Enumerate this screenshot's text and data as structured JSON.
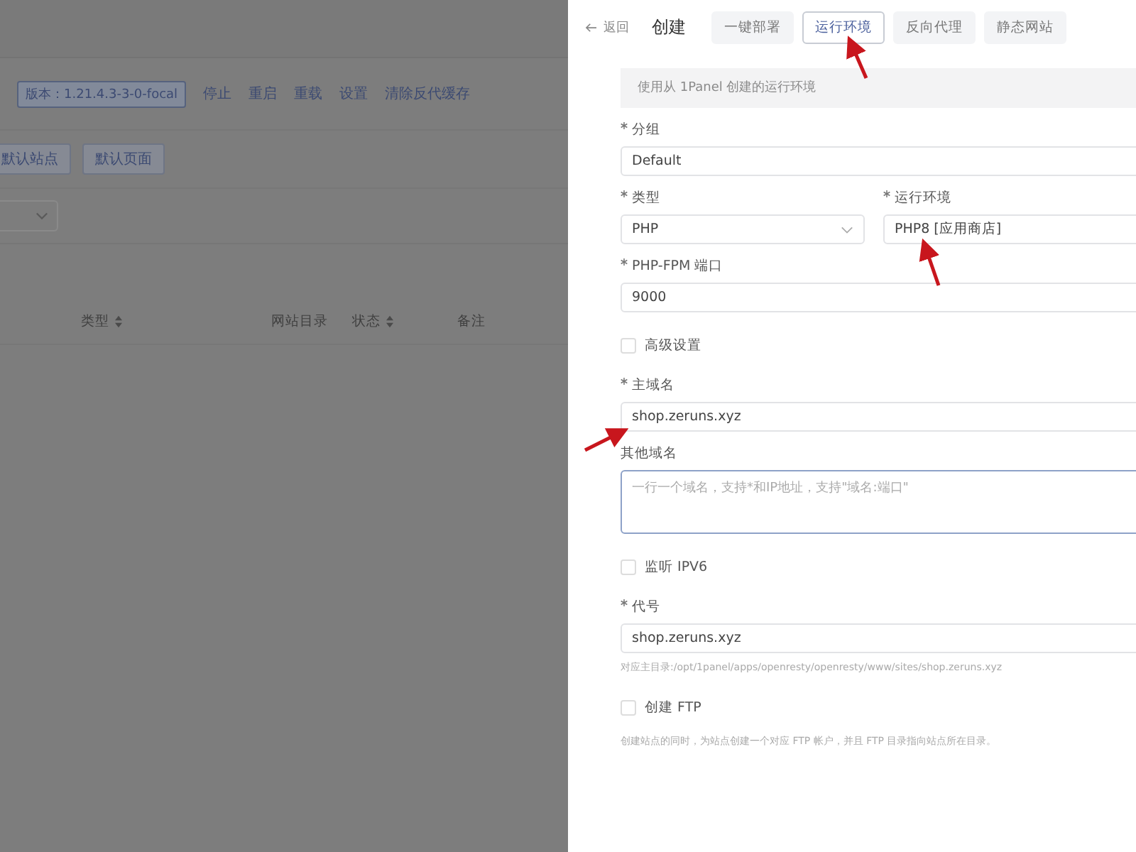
{
  "background_page": {
    "version_tag": "版本：1.21.4.3-3-0-focal",
    "actions": [
      "停止",
      "重启",
      "重载",
      "设置",
      "清除反代缓存"
    ],
    "site_buttons": [
      "默认站点",
      "默认页面"
    ],
    "table_columns": [
      {
        "label": "类型",
        "sortable": true
      },
      {
        "label": "网站目录",
        "sortable": false
      },
      {
        "label": "状态",
        "sortable": true
      },
      {
        "label": "备注",
        "sortable": false
      }
    ]
  },
  "drawer": {
    "back": "返回",
    "title": "创建",
    "tabs": [
      {
        "label": "一键部署",
        "selected": false
      },
      {
        "label": "运行环境",
        "selected": true
      },
      {
        "label": "反向代理",
        "selected": false
      },
      {
        "label": "静态网站",
        "selected": false
      }
    ],
    "notice": "使用从 1Panel 创建的运行环境",
    "fields": [
      {
        "kind": "input",
        "label": "分组",
        "required": true,
        "value": "Default"
      },
      {
        "kind": "pair",
        "items": [
          {
            "kind": "select",
            "label": "类型",
            "required": true,
            "value": "PHP"
          },
          {
            "kind": "input",
            "label": "运行环境",
            "required": true,
            "value": "PHP8 [应用商店]"
          }
        ]
      },
      {
        "kind": "input",
        "label": "PHP-FPM 端口",
        "required": true,
        "value": "9000"
      },
      {
        "kind": "checkbox",
        "label": "高级设置",
        "checked": false
      },
      {
        "kind": "input",
        "label": "主域名",
        "required": true,
        "value": "shop.zeruns.xyz"
      },
      {
        "kind": "textarea",
        "label": "其他域名",
        "required": false,
        "placeholder": "一行一个域名，支持*和IP地址，支持\"域名:端口\""
      },
      {
        "kind": "checkbox",
        "label": "监听 IPV6",
        "checked": false
      },
      {
        "kind": "input",
        "label": "代号",
        "required": true,
        "value": "shop.zeruns.xyz",
        "hint": "对应主目录:/opt/1panel/apps/openresty/openresty/www/sites/shop.zeruns.xyz"
      },
      {
        "kind": "checkbox",
        "label": "创建 FTP",
        "checked": false,
        "hint": "创建站点的同时，为站点创建一个对应 FTP 帐户，并且 FTP 目录指向站点所在目录。"
      }
    ]
  }
}
